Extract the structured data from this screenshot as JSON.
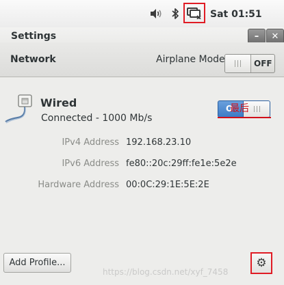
{
  "top_bar": {
    "clock": "Sat 01:51",
    "volume_icon": "volume-icon",
    "bluetooth_icon": "bluetooth-icon",
    "network_icon": "wired-network-icon"
  },
  "window": {
    "title": "Settings",
    "minimize_label": "–",
    "close_label": "✕"
  },
  "header": {
    "page_title": "Network",
    "airplane_label": "Airplane Mode",
    "airplane_state": "OFF"
  },
  "device": {
    "name": "Wired",
    "status": "Connected - 1000 Mb/s",
    "switch_text": "O",
    "details": [
      {
        "label": "IPv4 Address",
        "value": "192.168.23.10"
      },
      {
        "label": "IPv6 Address",
        "value": "fe80::20c:29ff:fe1e:5e2e"
      },
      {
        "label": "Hardware Address",
        "value": "00:0C:29:1E:5E:2E"
      }
    ]
  },
  "annotation": {
    "text": "最后"
  },
  "footer": {
    "add_profile_label": "Add Profile...",
    "settings_icon": "gear-icon"
  },
  "watermark": {
    "text": "https://blog.csdn.net/xyf_7458"
  },
  "colors": {
    "accent_blue": "#3d7cc6",
    "highlight_red": "#e01b24"
  }
}
